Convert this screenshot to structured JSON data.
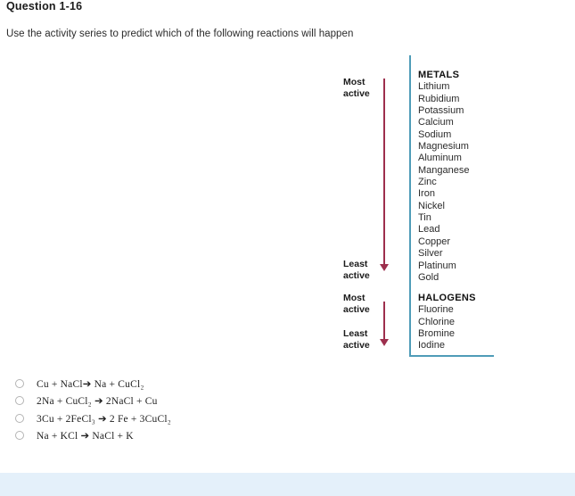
{
  "question": {
    "title": "Question 1-16",
    "prompt": "Use the activity series to predict which of the following reactions will happen"
  },
  "activity_series": {
    "metals": {
      "heading": "METALS",
      "most_active_label": "Most\nactive",
      "least_active_label": "Least\nactive",
      "items": [
        "Lithium",
        "Rubidium",
        "Potassium",
        "Calcium",
        "Sodium",
        "Magnesium",
        "Aluminum",
        "Manganese",
        "Zinc",
        "Iron",
        "Nickel",
        "Tin",
        "Lead",
        "Copper",
        "Silver",
        "Platinum",
        "Gold"
      ]
    },
    "halogens": {
      "heading": "HALOGENS",
      "most_active_label": "Most\nactive",
      "least_active_label": "Least\nactive",
      "items": [
        "Fluorine",
        "Chlorine",
        "Bromine",
        "Iodine"
      ]
    },
    "colors": {
      "bracket": "#4f9cb8",
      "arrow": "#9d2f4d"
    }
  },
  "answers": {
    "options": [
      {
        "equation": "Cu + NaCl➔  Na + CuCl₂",
        "selected": false
      },
      {
        "equation": "2Na + CuCl₂ ➔  2NaCl + Cu",
        "selected": false
      },
      {
        "equation": "3Cu + 2FeCl₃ ➔  2 Fe + 3CuCl₂",
        "selected": false
      },
      {
        "equation": "Na + KCl ➔  NaCl + K",
        "selected": false
      }
    ]
  },
  "bottom_bar": {
    "color": "#e4f0fa",
    "text": ""
  }
}
